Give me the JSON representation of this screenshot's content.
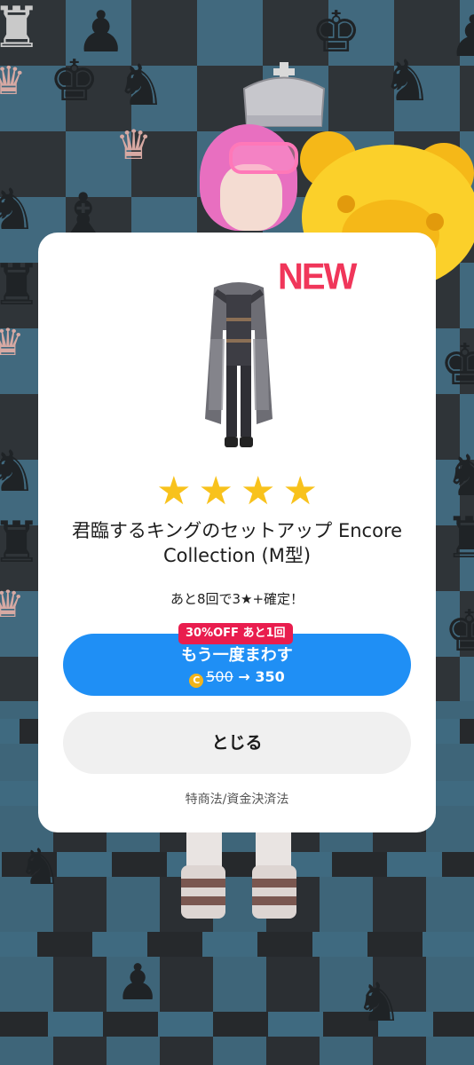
{
  "modal": {
    "new_badge": "NEW",
    "rarity_stars": 4,
    "star_glyph": "★",
    "item_name": "君臨するキングのセットアップ Encore Collection (M型)",
    "guarantee_text": "あと8回で3★+確定！",
    "discount_badge": "30%OFF あと1回",
    "spin_again_label": "もう一度まわす",
    "coin_icon": "coin-icon",
    "old_price": "500",
    "arrow": "→",
    "new_price": "350",
    "close_label": "とじる",
    "legal_link": "特商法/資金決済法"
  },
  "colors": {
    "new_badge": "#f0365a",
    "star": "#f8c21c",
    "primary_button": "#1f8ff5",
    "discount_badge": "#e91d4e",
    "secondary_button": "#f0f0f0"
  }
}
